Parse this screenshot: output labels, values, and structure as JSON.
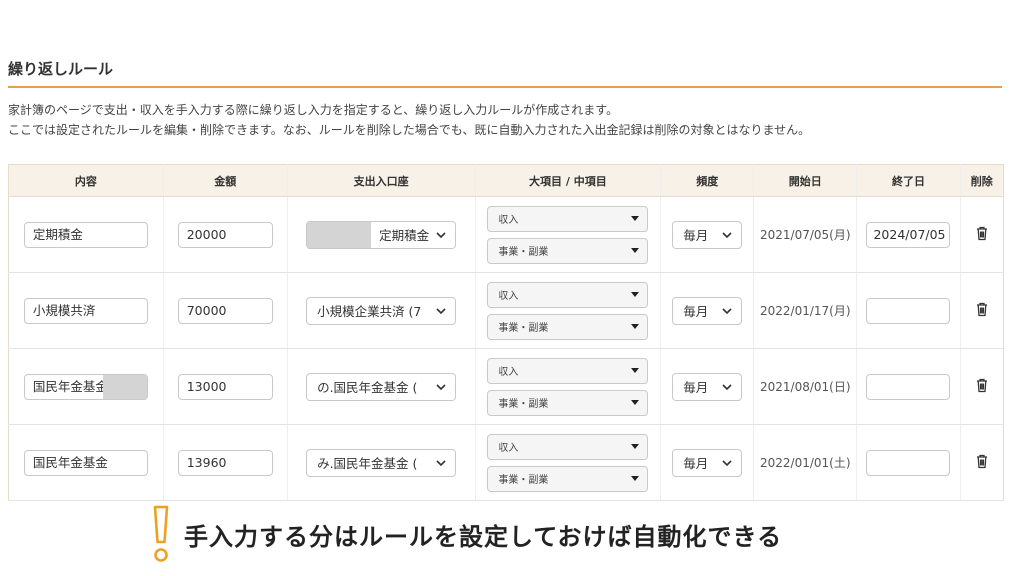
{
  "section": {
    "title": "繰り返しルール",
    "description_line1": "家計簿のページで支出・収入を手入力する際に繰り返し入力を指定すると、繰り返し入力ルールが作成されます。",
    "description_line2": "ここでは設定されたルールを編集・削除できます。なお、ルールを削除した場合でも、既に自動入力された入出金記録は削除の対象とはなりません。"
  },
  "table": {
    "headers": {
      "content": "内容",
      "amount": "金額",
      "account": "支出入口座",
      "category": "大項目 / 中項目",
      "frequency": "頻度",
      "start": "開始日",
      "end": "終了日",
      "delete": "削除"
    },
    "rows": [
      {
        "content": "定期積金",
        "amount": "20000",
        "account": "定期積金",
        "major": "収入",
        "minor": "事業・副業",
        "frequency": "毎月",
        "start": "2021/07/05(月)",
        "end": "2024/07/05"
      },
      {
        "content": "小規模共済",
        "amount": "70000",
        "account": "小規模企業共済 (7",
        "major": "収入",
        "minor": "事業・副業",
        "frequency": "毎月",
        "start": "2022/01/17(月)",
        "end": ""
      },
      {
        "content": "国民年金基金の",
        "amount": "13000",
        "account": "の.国民年金基金 (",
        "major": "収入",
        "minor": "事業・副業",
        "frequency": "毎月",
        "start": "2021/08/01(日)",
        "end": ""
      },
      {
        "content": "国民年金基金",
        "amount": "13960",
        "account": "み.国民年金基金 (",
        "major": "収入",
        "minor": "事業・副業",
        "frequency": "毎月",
        "start": "2022/01/01(土)",
        "end": ""
      }
    ]
  },
  "note": {
    "text": "手入力する分はルールを設定しておけば自動化できる",
    "icon": "exclamation-icon",
    "accent_color": "#f0a020"
  },
  "colors": {
    "accent_rule": "#e8a04a",
    "header_bg": "#f7f1e7"
  }
}
